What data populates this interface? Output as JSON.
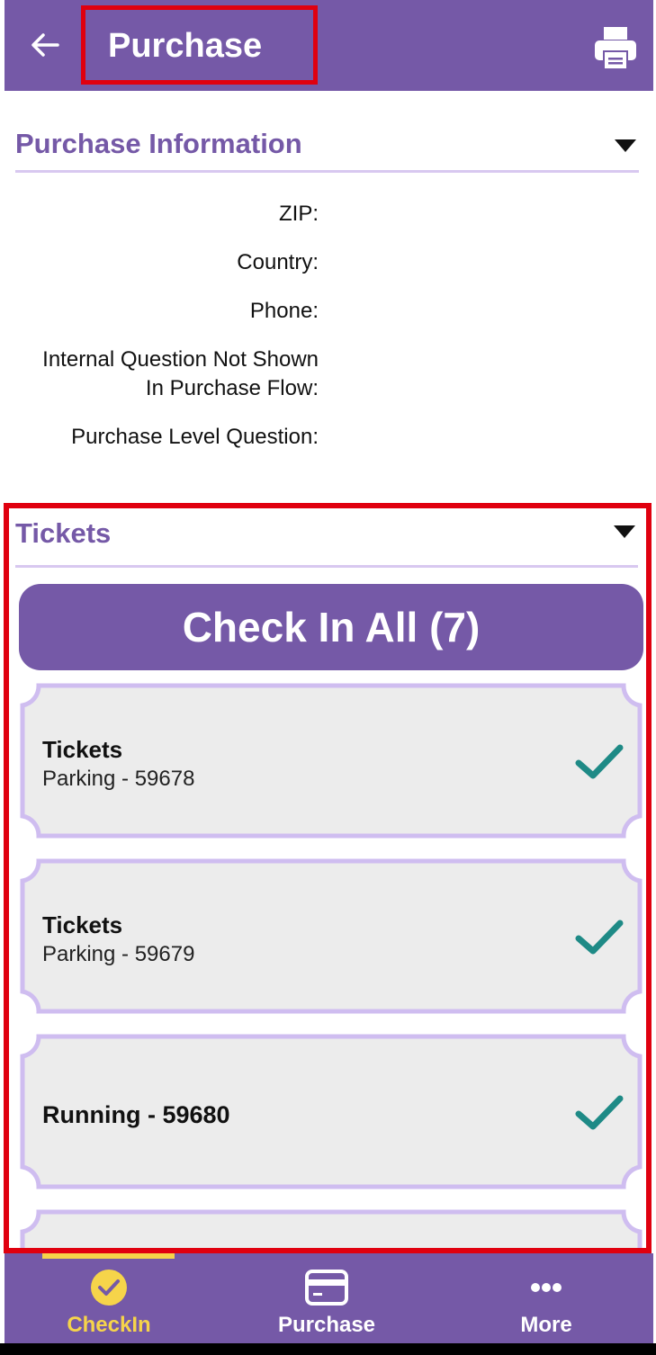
{
  "header": {
    "title": "Purchase",
    "back_icon": "back-arrow-icon",
    "print_icon": "printer-icon"
  },
  "purchase_info": {
    "heading": "Purchase Information",
    "fields": [
      {
        "label": "ZIP:"
      },
      {
        "label": "Country:"
      },
      {
        "label": "Phone:"
      },
      {
        "label_line1": "Internal Question Not Shown",
        "label_line2": "In Purchase Flow:"
      },
      {
        "label": "Purchase Level Question:"
      }
    ]
  },
  "tickets": {
    "heading": "Tickets",
    "check_in_all_label": "Check In All (7)",
    "items": [
      {
        "title": "Tickets",
        "subtitle": "Parking - 59678",
        "checked": true
      },
      {
        "title": "Tickets",
        "subtitle": "Parking - 59679",
        "checked": true
      },
      {
        "title": "Running - 59680",
        "subtitle": "",
        "checked": true
      }
    ]
  },
  "bottom_nav": {
    "items": [
      {
        "label": "CheckIn",
        "icon": "check-circle-icon",
        "active": true
      },
      {
        "label": "Purchase",
        "icon": "credit-card-icon",
        "active": false
      },
      {
        "label": "More",
        "icon": "more-dots-icon",
        "active": false
      }
    ]
  },
  "colors": {
    "primary": "#7559a7",
    "accent": "#f6d44a",
    "check": "#1e8a86",
    "highlight": "#e0000f"
  }
}
